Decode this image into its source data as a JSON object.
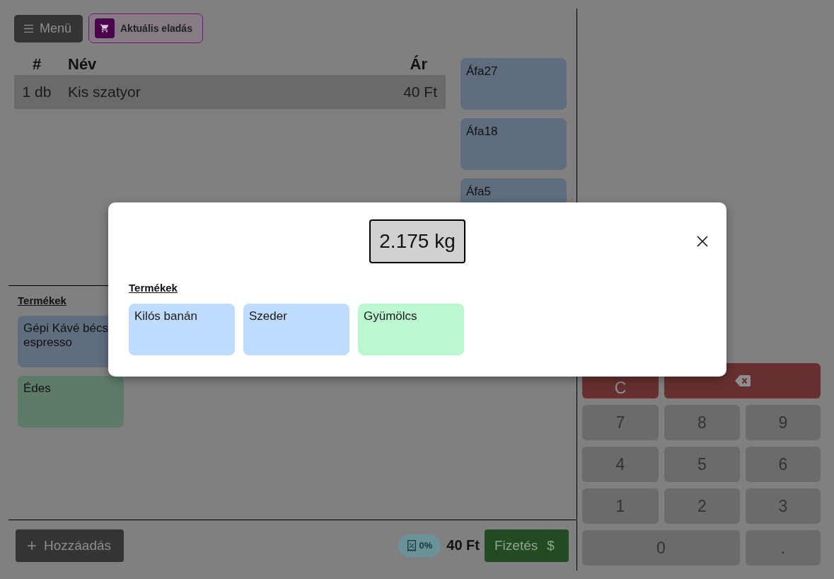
{
  "menu_button": {
    "label": "Menü"
  },
  "views": [
    {
      "label": "Aktuális eladás",
      "selected": true
    }
  ],
  "cart": {
    "columns": [
      "#",
      "Név",
      "Ár"
    ],
    "rows": [
      {
        "quantity": "1 db",
        "name": "Kis szatyor",
        "price": "40 Ft",
        "selected": true
      }
    ]
  },
  "vat_groups": [
    {
      "label": "Áfa27"
    },
    {
      "label": "Áfa18"
    },
    {
      "label": "Áfa5"
    }
  ],
  "products": {
    "title": "Termékek",
    "items": [
      {
        "label": "Gépi Kávé bécs espresso",
        "color": "#5f6d7f"
      },
      {
        "label": "Édes",
        "color": "#5d7b68"
      }
    ]
  },
  "footer": {
    "add_button": "Hozzáadás",
    "discount": "0%",
    "total": "40 Ft",
    "pay_button": {
      "label": "Fizetés",
      "symbol": "$"
    }
  },
  "keypad": [
    {
      "kind": "clear",
      "label": "C"
    },
    {
      "kind": "backspace"
    },
    {
      "kind": "key",
      "label": "7"
    },
    {
      "kind": "key",
      "label": "8"
    },
    {
      "kind": "key",
      "label": "9"
    },
    {
      "kind": "key",
      "label": "4"
    },
    {
      "kind": "key",
      "label": "5"
    },
    {
      "kind": "key",
      "label": "6"
    },
    {
      "kind": "key",
      "label": "1"
    },
    {
      "kind": "key",
      "label": "2"
    },
    {
      "kind": "key",
      "label": "3"
    },
    {
      "kind": "wide_key",
      "label": "0"
    },
    {
      "kind": "key",
      "label": "."
    }
  ],
  "weight_dialog": {
    "reading": "2.175 kg",
    "title": "Termékek",
    "products": [
      {
        "label": "Kilós banán",
        "color": "#bfdbfe"
      },
      {
        "label": "Szeder",
        "color": "#bfdbfe"
      },
      {
        "label": "Gyümölcs",
        "color": "#bbf7d0"
      }
    ]
  }
}
